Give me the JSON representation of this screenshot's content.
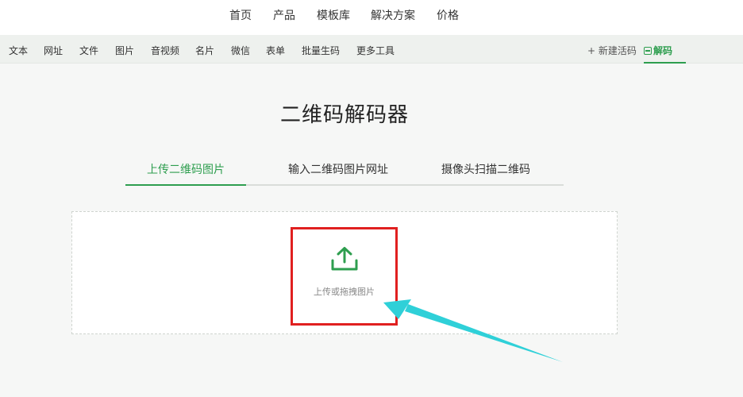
{
  "topnav": {
    "items": [
      "首页",
      "产品",
      "模板库",
      "解决方案",
      "价格"
    ]
  },
  "subnav": {
    "items": [
      "文本",
      "网址",
      "文件",
      "图片",
      "音视频",
      "名片",
      "微信",
      "表单",
      "批量生码",
      "更多工具"
    ],
    "new_code": "+ 新建活码",
    "decode": "解码"
  },
  "main": {
    "title": "二维码解码器",
    "tabs": [
      {
        "label": "上传二维码图片",
        "active": true
      },
      {
        "label": "输入二维码图片网址",
        "active": false
      },
      {
        "label": "摄像头扫描二维码",
        "active": false
      }
    ],
    "upload": {
      "label": "上传或拖拽图片",
      "icon": "upload-icon"
    }
  },
  "colors": {
    "accent": "#2e9e4f",
    "highlight_box": "#e02020",
    "annotation_arrow": "#2fd0d8"
  }
}
